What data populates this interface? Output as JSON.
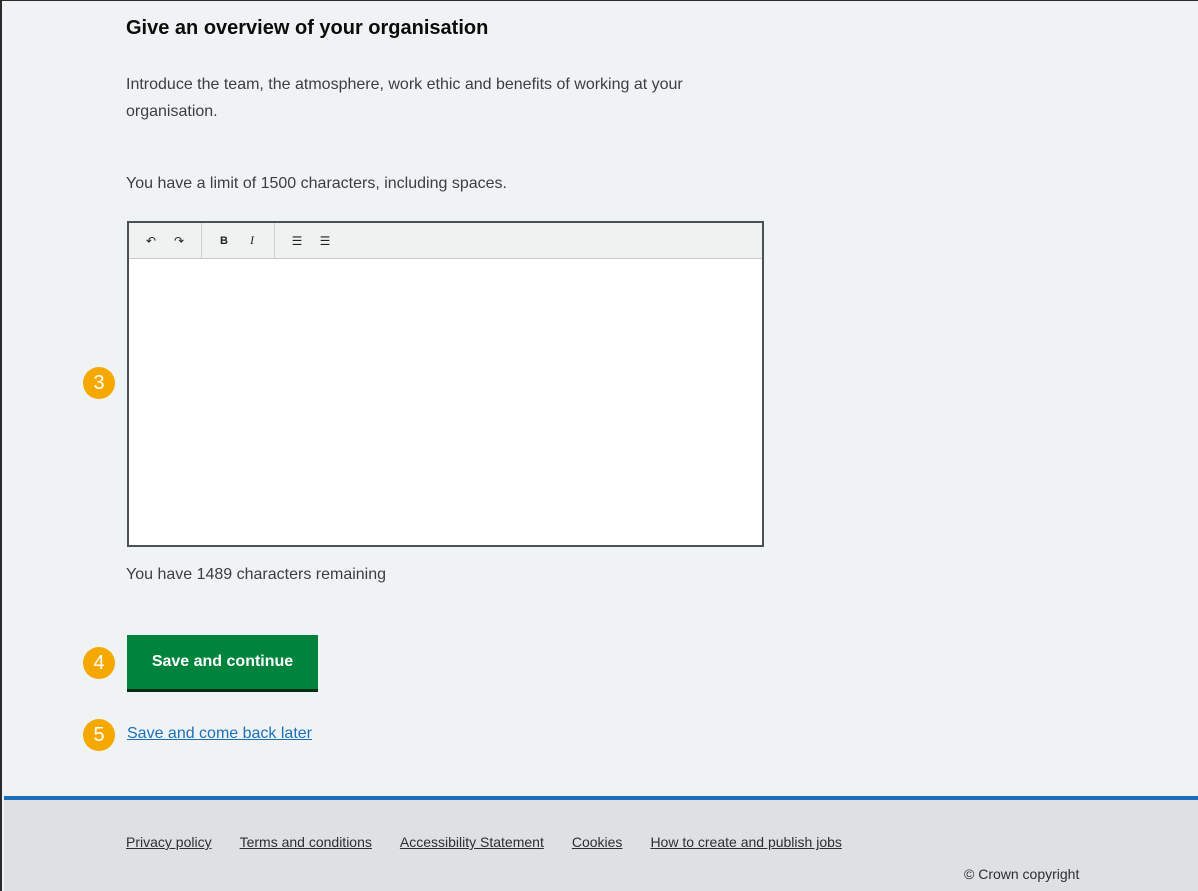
{
  "form": {
    "heading": "Give an overview of your organisation",
    "intro": "Introduce the team, the atmosphere, work ethic and benefits of working at your organisation.",
    "limit_hint": "You have a limit of 1500 characters, including spaces.",
    "remaining": "You have 1489 characters remaining",
    "editor_value": ""
  },
  "toolbar": {
    "undo_glyph": "↶",
    "redo_glyph": "↷",
    "bold_glyph": "B",
    "italic_glyph": "I",
    "bullet_glyph": "☰",
    "numbered_glyph": "☰"
  },
  "actions": {
    "save_continue_label": "Save and continue",
    "save_later_label": "Save and come back later"
  },
  "markers": {
    "m3": "3",
    "m4": "4",
    "m5": "5",
    "color": "#f5a800"
  },
  "footer": {
    "links": [
      "Privacy policy",
      "Terms and conditions",
      "Accessibility Statement",
      "Cookies",
      "How to create and publish jobs"
    ],
    "copyright": "© Crown copyright"
  },
  "colors": {
    "primary_button": "#00843d",
    "link": "#1d70b8",
    "footer_accent": "#1d70b8"
  }
}
